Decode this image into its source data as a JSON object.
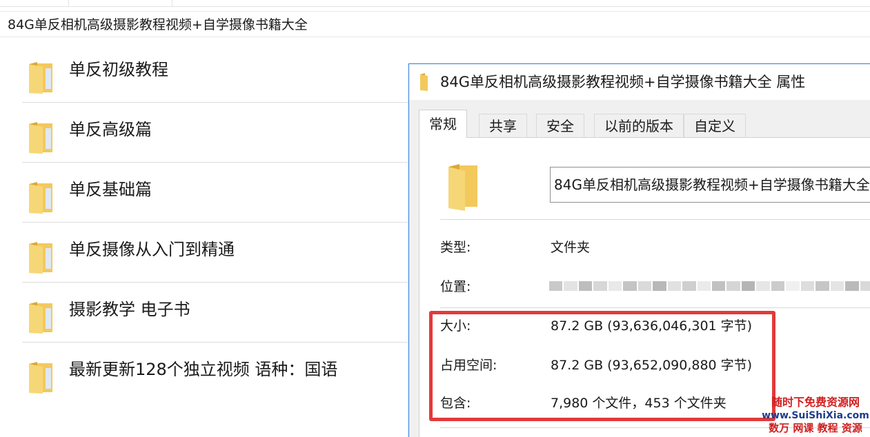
{
  "explorer": {
    "address": "84G单反相机高级摄影教程视频+自学摄像书籍大全",
    "folders": [
      {
        "name": "单反初级教程",
        "icon": "folder-icon"
      },
      {
        "name": "单反高级篇",
        "icon": "folder-icon"
      },
      {
        "name": "单反基础篇",
        "icon": "folder-icon"
      },
      {
        "name": "单反摄像从入门到精通",
        "icon": "folder-icon"
      },
      {
        "name": "摄影教学 电子书",
        "icon": "folder-icon"
      },
      {
        "name": "最新更新128个独立视频 语种：国语",
        "icon": "folder-icon"
      }
    ]
  },
  "dialog": {
    "title": "84G单反相机高级摄影教程视频+自学摄像书籍大全 属性",
    "tabs": [
      {
        "label": "常规",
        "active": true
      },
      {
        "label": "共享",
        "active": false
      },
      {
        "label": "安全",
        "active": false
      },
      {
        "label": "以前的版本",
        "active": false
      },
      {
        "label": "自定义",
        "active": false
      }
    ],
    "folder_name": "84G单反相机高级摄影教程视频+自学摄像书籍大全",
    "type_label": "类型:",
    "type_value": "文件夹",
    "location_label": "位置:",
    "size_label": "大小:",
    "size_value": "87.2 GB (93,636,046,301 字节)",
    "disk_label": "占用空间:",
    "disk_value": "87.2 GB (93,652,090,880 字节)",
    "contains_label": "包含:",
    "contains_value": "7,980 个文件，453 个文件夹"
  },
  "watermark": {
    "line1": "随时下免费资源网",
    "line2": "www.SuiShiXia.com",
    "line3": "数万 网课 教程 资源"
  },
  "colors": {
    "highlight": "#e23a3a",
    "dialog_border": "#2b79d8",
    "folder_yellow": "#f3c95c"
  }
}
